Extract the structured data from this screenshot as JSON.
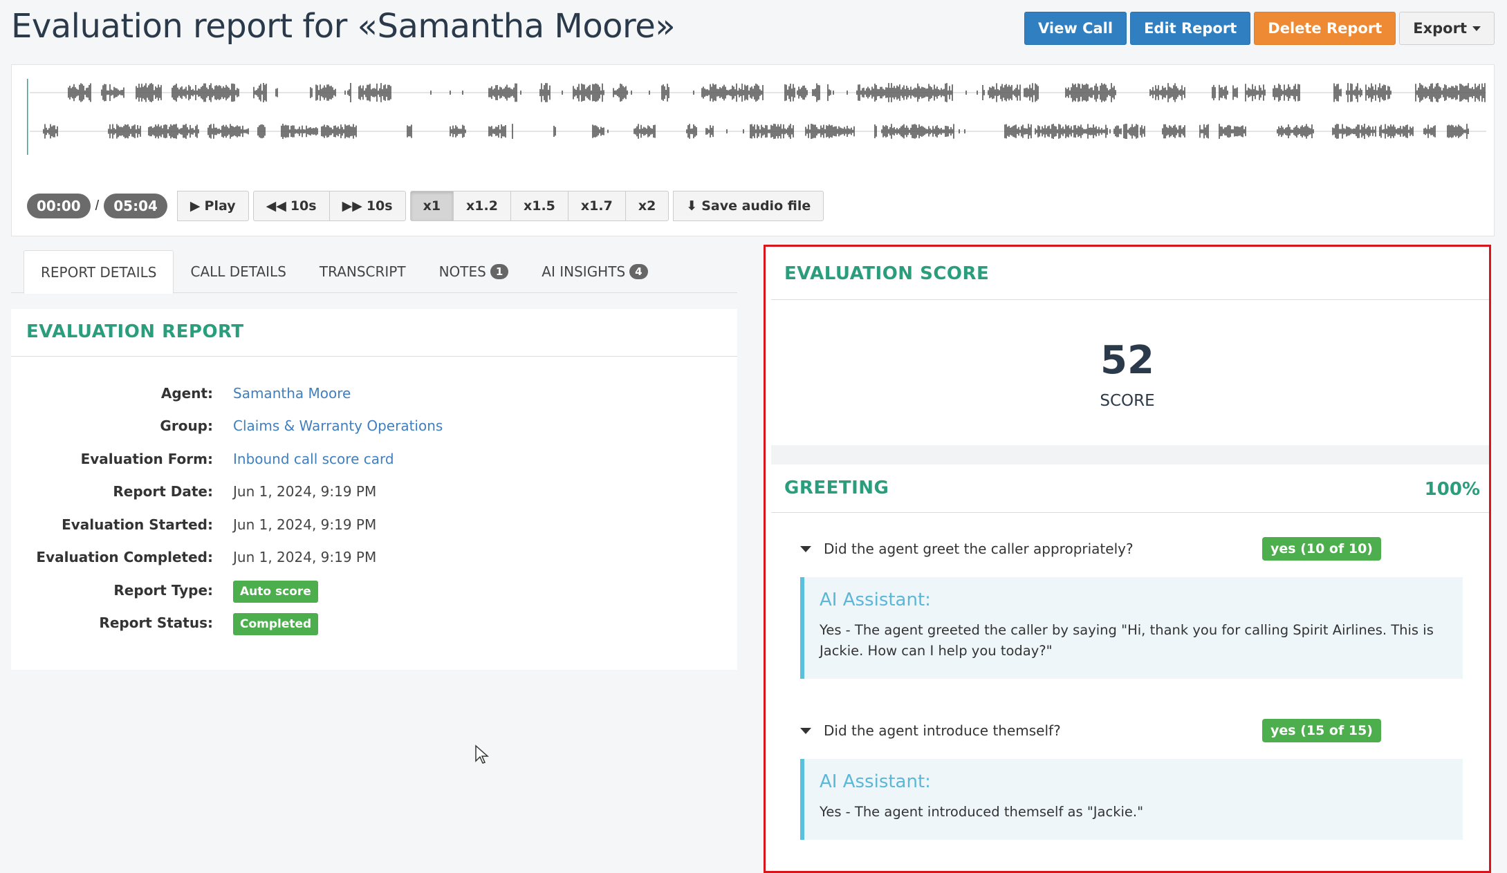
{
  "page": {
    "title": "Evaluation report for «Samantha Moore»"
  },
  "actions": {
    "view_call": "View Call",
    "edit_report": "Edit Report",
    "delete_report": "Delete Report",
    "export": "Export"
  },
  "colors": {
    "primary": "#2f7fc1",
    "danger_orange": "#ef8a34",
    "accent_green": "#2a9d7c",
    "highlight_red": "#d9151b"
  },
  "player": {
    "current_time": "00:00",
    "separator": "/",
    "duration": "05:04",
    "play": "Play",
    "rewind": "10s",
    "forward": "10s",
    "speeds": [
      "x1",
      "x1.2",
      "x1.5",
      "x1.7",
      "x2"
    ],
    "active_speed": "x1",
    "save_audio": "Save audio file"
  },
  "tabs": [
    {
      "label": "REPORT DETAILS",
      "active": true
    },
    {
      "label": "CALL DETAILS"
    },
    {
      "label": "TRANSCRIPT"
    },
    {
      "label": "NOTES",
      "badge": "1"
    },
    {
      "label": "AI INSIGHTS",
      "badge": "4"
    }
  ],
  "report": {
    "title": "EVALUATION REPORT",
    "rows": [
      {
        "label": "Agent:",
        "value": "Samantha Moore"
      },
      {
        "label": "Group:",
        "value": "Claims & Warranty Operations"
      },
      {
        "label": "Evaluation Form:",
        "value": "Inbound call score card"
      },
      {
        "label": "Report Date:",
        "value": "Jun 1, 2024, 9:19 PM"
      },
      {
        "label": "Evaluation Started:",
        "value": "Jun 1, 2024, 9:19 PM"
      },
      {
        "label": "Evaluation Completed:",
        "value": "Jun 1, 2024, 9:19 PM"
      },
      {
        "label": "Report Type:",
        "value": "Auto score"
      },
      {
        "label": "Report Status:",
        "value": "Completed"
      }
    ]
  },
  "score": {
    "title": "EVALUATION SCORE",
    "value": "52",
    "label": "SCORE",
    "section": "GREETING",
    "section_pct": "100%",
    "questions": [
      {
        "text": "Did the agent greet the caller appropriately?",
        "answer": "yes (10 of 10)",
        "ai_title": "AI Assistant:",
        "ai_text": "Yes - The agent greeted the caller by saying \"Hi, thank you for calling Spirit Airlines. This is Jackie. How can I help you today?\""
      },
      {
        "text": "Did the agent introduce themself?",
        "answer": "yes (15 of 15)",
        "ai_title": "AI Assistant:",
        "ai_text": "Yes - The agent introduced themself as \"Jackie.\""
      }
    ]
  }
}
